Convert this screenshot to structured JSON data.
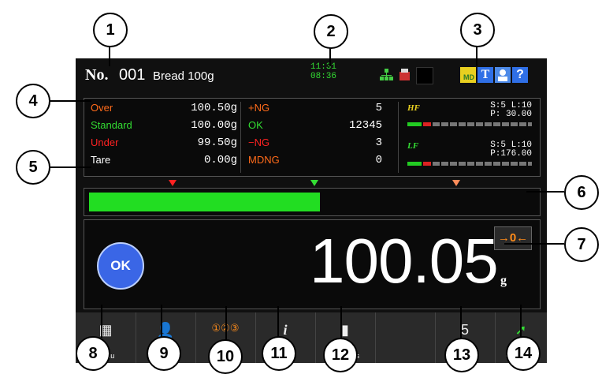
{
  "header": {
    "no_label": "No.",
    "product_no": "001",
    "product_name": "Bread 100g",
    "time_top": "11:31",
    "time_bottom": "08:36"
  },
  "stats": {
    "over_label": "Over",
    "over_value": "100.50g",
    "standard_label": "Standard",
    "standard_value": "100.00g",
    "under_label": "Under",
    "under_value": "99.50g",
    "tare_label": "Tare",
    "tare_value": "0.00g",
    "plus_ng_label": "+NG",
    "plus_ng_value": "5",
    "ok_label": "OK",
    "ok_value": "12345",
    "minus_ng_label": "−NG",
    "minus_ng_value": "3",
    "mdng_label": "MDNG",
    "mdng_value": "0"
  },
  "filters": {
    "hf_label": "HF",
    "hf_sl": "S:5 L:10",
    "hf_p": "P: 30.00",
    "lf_label": "LF",
    "lf_sl": "S:5 L:10",
    "lf_p": "P:176.00"
  },
  "weight": {
    "judgement": "OK",
    "value": "100.05",
    "unit": "g",
    "zero_button": "→0←",
    "bar_fill_fraction": 0.52
  },
  "footer": {
    "menu": "Menu",
    "user": "User",
    "screen": "Screen",
    "screen_icon": "①②③",
    "info": "Info...",
    "statistics": "Statistics",
    "rate_value": "5",
    "rate": "ea/min",
    "conveyor": "Conveyor"
  },
  "callouts": [
    "1",
    "2",
    "3",
    "4",
    "5",
    "6",
    "7",
    "8",
    "9",
    "10",
    "11",
    "12",
    "13",
    "14"
  ],
  "colors": {
    "over": "#ff6b1a",
    "standard": "#33dd33",
    "under": "#ff2222",
    "bar": "#22dd22",
    "ok_circle": "#3a66e6"
  }
}
